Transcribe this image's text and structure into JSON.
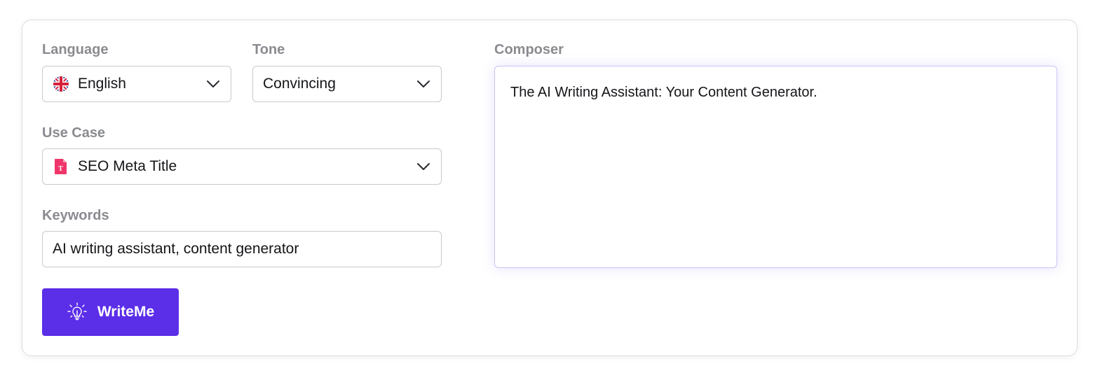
{
  "form": {
    "language": {
      "label": "Language",
      "value": "English",
      "icon": "uk-flag-icon"
    },
    "tone": {
      "label": "Tone",
      "value": "Convincing"
    },
    "use_case": {
      "label": "Use Case",
      "value": "SEO Meta Title",
      "icon": "text-document-icon"
    },
    "keywords": {
      "label": "Keywords",
      "value": "AI writing assistant, content generator"
    },
    "submit": {
      "label": "WriteMe",
      "icon": "lightbulb-icon"
    }
  },
  "composer": {
    "label": "Composer",
    "text": "The AI Writing Assistant: Your Content Generator."
  },
  "colors": {
    "accent": "#5b2ee8",
    "label": "#8a8b90",
    "doc_icon": "#f0356b"
  }
}
